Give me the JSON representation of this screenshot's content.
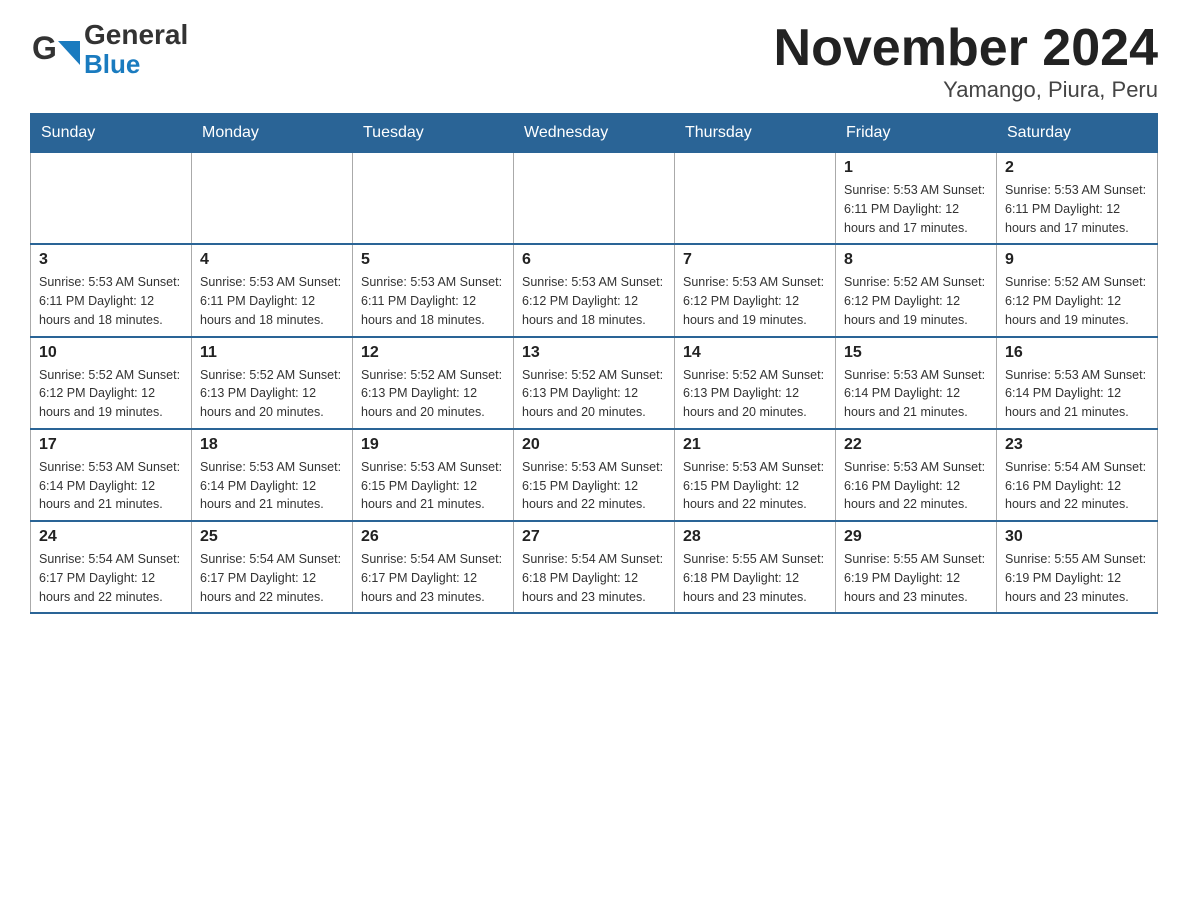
{
  "header": {
    "logo_general": "General",
    "logo_blue": "Blue",
    "title": "November 2024",
    "subtitle": "Yamango, Piura, Peru"
  },
  "calendar": {
    "days_of_week": [
      "Sunday",
      "Monday",
      "Tuesday",
      "Wednesday",
      "Thursday",
      "Friday",
      "Saturday"
    ],
    "weeks": [
      [
        {
          "day": "",
          "info": ""
        },
        {
          "day": "",
          "info": ""
        },
        {
          "day": "",
          "info": ""
        },
        {
          "day": "",
          "info": ""
        },
        {
          "day": "",
          "info": ""
        },
        {
          "day": "1",
          "info": "Sunrise: 5:53 AM\nSunset: 6:11 PM\nDaylight: 12 hours\nand 17 minutes."
        },
        {
          "day": "2",
          "info": "Sunrise: 5:53 AM\nSunset: 6:11 PM\nDaylight: 12 hours\nand 17 minutes."
        }
      ],
      [
        {
          "day": "3",
          "info": "Sunrise: 5:53 AM\nSunset: 6:11 PM\nDaylight: 12 hours\nand 18 minutes."
        },
        {
          "day": "4",
          "info": "Sunrise: 5:53 AM\nSunset: 6:11 PM\nDaylight: 12 hours\nand 18 minutes."
        },
        {
          "day": "5",
          "info": "Sunrise: 5:53 AM\nSunset: 6:11 PM\nDaylight: 12 hours\nand 18 minutes."
        },
        {
          "day": "6",
          "info": "Sunrise: 5:53 AM\nSunset: 6:12 PM\nDaylight: 12 hours\nand 18 minutes."
        },
        {
          "day": "7",
          "info": "Sunrise: 5:53 AM\nSunset: 6:12 PM\nDaylight: 12 hours\nand 19 minutes."
        },
        {
          "day": "8",
          "info": "Sunrise: 5:52 AM\nSunset: 6:12 PM\nDaylight: 12 hours\nand 19 minutes."
        },
        {
          "day": "9",
          "info": "Sunrise: 5:52 AM\nSunset: 6:12 PM\nDaylight: 12 hours\nand 19 minutes."
        }
      ],
      [
        {
          "day": "10",
          "info": "Sunrise: 5:52 AM\nSunset: 6:12 PM\nDaylight: 12 hours\nand 19 minutes."
        },
        {
          "day": "11",
          "info": "Sunrise: 5:52 AM\nSunset: 6:13 PM\nDaylight: 12 hours\nand 20 minutes."
        },
        {
          "day": "12",
          "info": "Sunrise: 5:52 AM\nSunset: 6:13 PM\nDaylight: 12 hours\nand 20 minutes."
        },
        {
          "day": "13",
          "info": "Sunrise: 5:52 AM\nSunset: 6:13 PM\nDaylight: 12 hours\nand 20 minutes."
        },
        {
          "day": "14",
          "info": "Sunrise: 5:52 AM\nSunset: 6:13 PM\nDaylight: 12 hours\nand 20 minutes."
        },
        {
          "day": "15",
          "info": "Sunrise: 5:53 AM\nSunset: 6:14 PM\nDaylight: 12 hours\nand 21 minutes."
        },
        {
          "day": "16",
          "info": "Sunrise: 5:53 AM\nSunset: 6:14 PM\nDaylight: 12 hours\nand 21 minutes."
        }
      ],
      [
        {
          "day": "17",
          "info": "Sunrise: 5:53 AM\nSunset: 6:14 PM\nDaylight: 12 hours\nand 21 minutes."
        },
        {
          "day": "18",
          "info": "Sunrise: 5:53 AM\nSunset: 6:14 PM\nDaylight: 12 hours\nand 21 minutes."
        },
        {
          "day": "19",
          "info": "Sunrise: 5:53 AM\nSunset: 6:15 PM\nDaylight: 12 hours\nand 21 minutes."
        },
        {
          "day": "20",
          "info": "Sunrise: 5:53 AM\nSunset: 6:15 PM\nDaylight: 12 hours\nand 22 minutes."
        },
        {
          "day": "21",
          "info": "Sunrise: 5:53 AM\nSunset: 6:15 PM\nDaylight: 12 hours\nand 22 minutes."
        },
        {
          "day": "22",
          "info": "Sunrise: 5:53 AM\nSunset: 6:16 PM\nDaylight: 12 hours\nand 22 minutes."
        },
        {
          "day": "23",
          "info": "Sunrise: 5:54 AM\nSunset: 6:16 PM\nDaylight: 12 hours\nand 22 minutes."
        }
      ],
      [
        {
          "day": "24",
          "info": "Sunrise: 5:54 AM\nSunset: 6:17 PM\nDaylight: 12 hours\nand 22 minutes."
        },
        {
          "day": "25",
          "info": "Sunrise: 5:54 AM\nSunset: 6:17 PM\nDaylight: 12 hours\nand 22 minutes."
        },
        {
          "day": "26",
          "info": "Sunrise: 5:54 AM\nSunset: 6:17 PM\nDaylight: 12 hours\nand 23 minutes."
        },
        {
          "day": "27",
          "info": "Sunrise: 5:54 AM\nSunset: 6:18 PM\nDaylight: 12 hours\nand 23 minutes."
        },
        {
          "day": "28",
          "info": "Sunrise: 5:55 AM\nSunset: 6:18 PM\nDaylight: 12 hours\nand 23 minutes."
        },
        {
          "day": "29",
          "info": "Sunrise: 5:55 AM\nSunset: 6:19 PM\nDaylight: 12 hours\nand 23 minutes."
        },
        {
          "day": "30",
          "info": "Sunrise: 5:55 AM\nSunset: 6:19 PM\nDaylight: 12 hours\nand 23 minutes."
        }
      ]
    ]
  }
}
